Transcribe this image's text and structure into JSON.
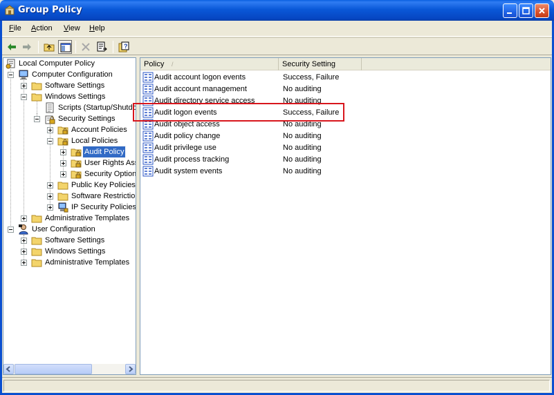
{
  "window": {
    "title": "Group Policy"
  },
  "menu": {
    "items": [
      {
        "label": "File",
        "underline": "F",
        "rest": "ile"
      },
      {
        "label": "Action",
        "underline": "A",
        "rest": "ction"
      },
      {
        "label": "View",
        "underline": "V",
        "rest": "iew"
      },
      {
        "label": "Help",
        "underline": "H",
        "rest": "elp"
      }
    ]
  },
  "toolbar": {
    "icons": [
      "back-arrow-icon",
      "forward-arrow-icon",
      "up-folder-icon",
      "show-hide-tree-icon",
      "delete-icon",
      "export-list-icon",
      "help-icon"
    ]
  },
  "tree": {
    "items": [
      {
        "label": "Local Computer Policy"
      },
      {
        "label": "Computer Configuration"
      },
      {
        "label": "Software Settings"
      },
      {
        "label": "Windows Settings"
      },
      {
        "label": "Scripts (Startup/Shutdo"
      },
      {
        "label": "Security Settings"
      },
      {
        "label": "Account Policies"
      },
      {
        "label": "Local Policies"
      },
      {
        "label": "Audit Policy"
      },
      {
        "label": "User Rights Ass"
      },
      {
        "label": "Security Option"
      },
      {
        "label": "Public Key Policies"
      },
      {
        "label": "Software Restriction"
      },
      {
        "label": "IP Security Policies ("
      },
      {
        "label": "Administrative Templates"
      },
      {
        "label": "User Configuration"
      },
      {
        "label": "Software Settings"
      },
      {
        "label": "Windows Settings"
      },
      {
        "label": "Administrative Templates"
      }
    ],
    "selected": "Audit Policy"
  },
  "list": {
    "columns": [
      {
        "label": "Policy",
        "sort_glyph": "/"
      },
      {
        "label": "Security Setting"
      }
    ],
    "rows": [
      {
        "policy": "Audit account logon events",
        "setting": "Success, Failure"
      },
      {
        "policy": "Audit account management",
        "setting": "No auditing"
      },
      {
        "policy": "Audit directory service access",
        "setting": "No auditing"
      },
      {
        "policy": "Audit logon events",
        "setting": "Success, Failure"
      },
      {
        "policy": "Audit object access",
        "setting": "No auditing"
      },
      {
        "policy": "Audit policy change",
        "setting": "No auditing"
      },
      {
        "policy": "Audit privilege use",
        "setting": "No auditing"
      },
      {
        "policy": "Audit process tracking",
        "setting": "No auditing"
      },
      {
        "policy": "Audit system events",
        "setting": "No auditing"
      }
    ],
    "highlighted_row": "Audit logon events"
  },
  "colors": {
    "titlebar": "#0a58d8",
    "selection": "#316ac5",
    "highlight_box": "#d8151c"
  }
}
